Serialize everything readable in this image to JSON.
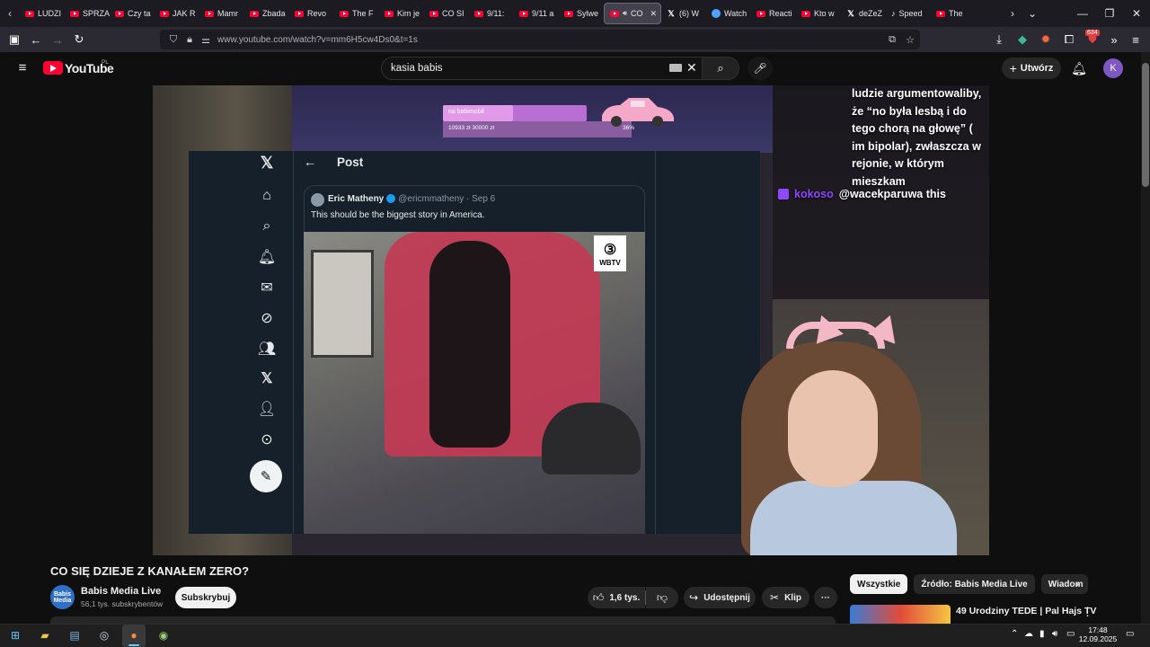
{
  "browser": {
    "tabs": [
      {
        "label": "LUDZI",
        "type": "yt"
      },
      {
        "label": "SPRZA",
        "type": "yt"
      },
      {
        "label": "Czy ta",
        "type": "yt"
      },
      {
        "label": "JAK R",
        "type": "yt"
      },
      {
        "label": "Mamr",
        "type": "yt"
      },
      {
        "label": "Zbada",
        "type": "yt"
      },
      {
        "label": "Revo",
        "type": "yt"
      },
      {
        "label": "The F",
        "type": "yt"
      },
      {
        "label": "Kim je",
        "type": "yt"
      },
      {
        "label": "CO SI",
        "type": "yt"
      },
      {
        "label": "9/11:",
        "type": "yt"
      },
      {
        "label": "9/11 a",
        "type": "yt"
      },
      {
        "label": "Sylwe",
        "type": "yt"
      },
      {
        "label": "CO",
        "type": "yt-active"
      },
      {
        "label": "(6) W",
        "type": "x"
      },
      {
        "label": "Watch",
        "type": "watch"
      },
      {
        "label": "Reacti",
        "type": "yt"
      },
      {
        "label": "Kto w",
        "type": "yt"
      },
      {
        "label": "deZeZ",
        "type": "x"
      },
      {
        "label": "Speed",
        "type": "tiktok"
      },
      {
        "label": "The",
        "type": "yt"
      }
    ],
    "url": "www.youtube.com/watch?v=mm6H5cw4Ds0&t=1s",
    "badge_count": "634"
  },
  "youtube": {
    "logo_text": "YouTube",
    "region": "PL",
    "search_value": "kasia babis",
    "create_label": "Utwórz",
    "avatar_letter": "K"
  },
  "video": {
    "donation": {
      "label": "na babimobil",
      "amount": "10933 zł 30000 zł",
      "percent": "36%",
      "fraction": 0.36
    },
    "tweet": {
      "header": "Post",
      "author": "Eric Matheny",
      "handle": "@ericmmatheny · Sep 6",
      "text": "This should be the biggest story in America.",
      "station_logo": "WBTV"
    },
    "chat": {
      "lines": [
        "ludzie argumentowaliby,",
        "że “no była lesbą i do",
        "tego chorą na głowę” (",
        "im bipolar), zwłaszcza w",
        "rejonie, w którym",
        "mieszkam"
      ],
      "username": "kokoso",
      "mention": "@wacekparuwa this"
    }
  },
  "below": {
    "title": "CO SIĘ DZIEJE Z KANAŁEM ZERO?",
    "channel_name": "Babis Media Live",
    "channel_avatar_text": "Babis Media",
    "subscribers": "56,1 tys. subskrybentów",
    "subscribe_label": "Subskrybuj",
    "likes": "1,6 tys.",
    "share_label": "Udostępnij",
    "clip_label": "Klip",
    "more_label": "···",
    "chips": [
      "Wszystkie",
      "Źródło: Babis Media Live",
      "Wiadom"
    ],
    "rec_title": "49 Urodziny TEDE | Pal Hajs TV"
  },
  "taskbar": {
    "time": "17:48",
    "date": "12.09.2025"
  }
}
